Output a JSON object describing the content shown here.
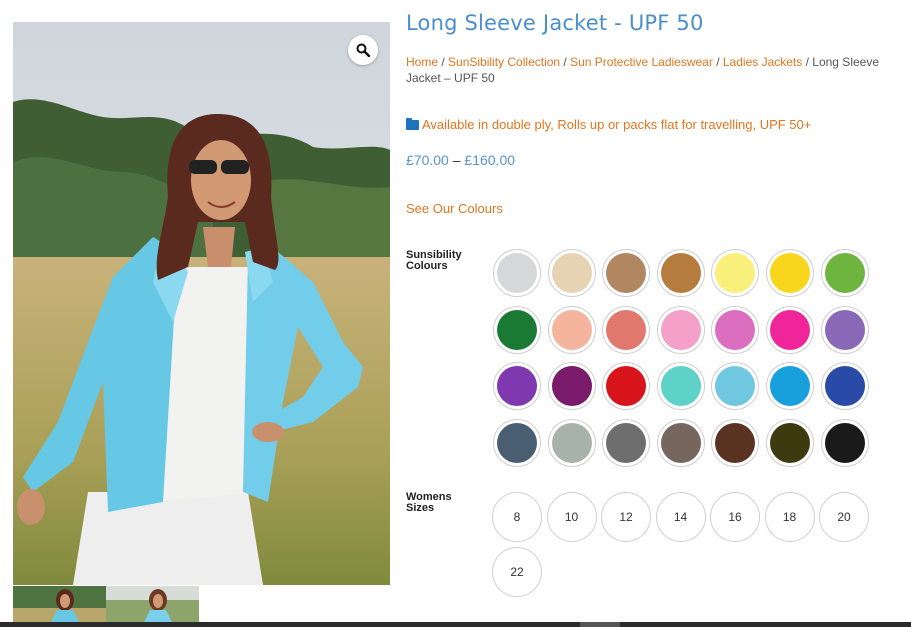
{
  "product": {
    "title": "Long Sleeve Jacket - UPF 50",
    "breadcrumb": {
      "home": "Home",
      "sep": " / ",
      "collection": "SunSibility Collection",
      "category": "Sun Protective Ladieswear",
      "subcategory": "Ladies Jackets",
      "current": "Long Sleeve Jacket – UPF 50"
    },
    "feature_text": "Available in double ply, Rolls up or packs flat for travelling, UPF 50+",
    "price_low": "£70.00",
    "price_sep": "–",
    "price_high": "£160.00",
    "see_colours": "See Our Colours"
  },
  "options": {
    "colours_label_line1": "Sunsibility",
    "colours_label_line2": "Colours",
    "sizes_label_line1": "Womens",
    "sizes_label_line2": "Sizes",
    "colours": [
      "#d6d7d9",
      "#e6d3b2",
      "#b08760",
      "#b67c3e",
      "#f8f07a",
      "#f8d61d",
      "#6db53f",
      "#1a7a34",
      "#f4b49e",
      "#e0786e",
      "#f4a0c8",
      "#dc6ec0",
      "#f0259a",
      "#8a68b8",
      "#8038b0",
      "#7a1a6a",
      "#d8141c",
      "#5fd2c8",
      "#70c8e0",
      "#18a0dc",
      "#2a4aa8",
      "#4a5e72",
      "#a8b2ac",
      "#6e6e6e",
      "#76675e",
      "#5a3222",
      "#3e3a10",
      "#1a1a1a"
    ],
    "sizes": [
      "8",
      "10",
      "12",
      "14",
      "16",
      "18",
      "20",
      "22"
    ]
  },
  "icons": {
    "zoom": "magnifier-icon",
    "feature": "folder-icon"
  }
}
